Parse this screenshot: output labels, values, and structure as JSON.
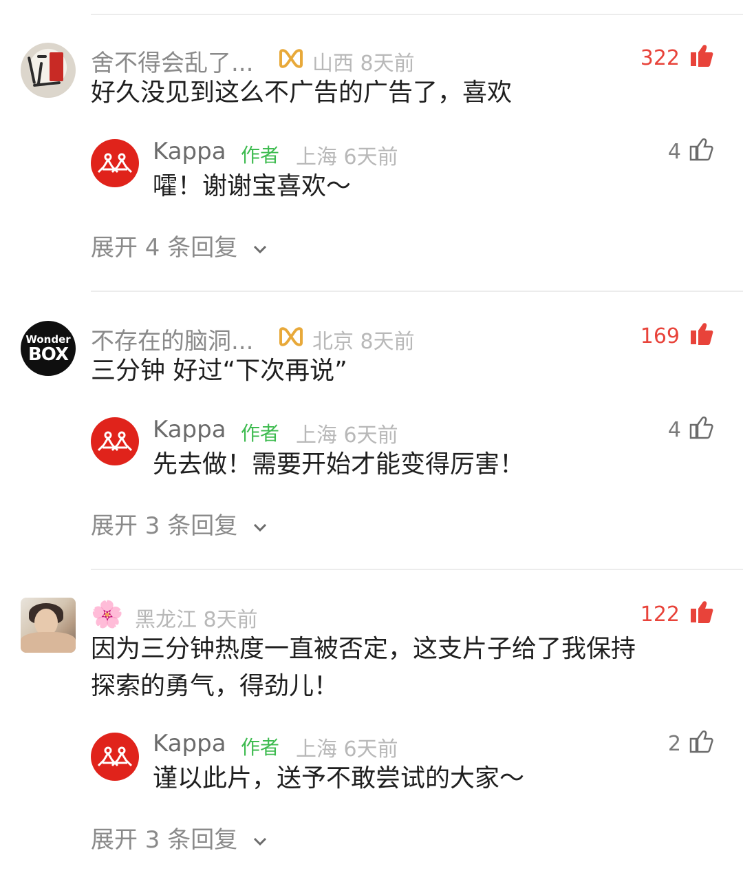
{
  "colors": {
    "accent_red": "#e8433a",
    "author_green": "#3dbb4f",
    "kappa_red": "#e0231b"
  },
  "comments": [
    {
      "user": "舍不得会乱了...",
      "badge_icon": "gold-infinity-icon",
      "location": "山西",
      "time": "8天前",
      "likes": "322",
      "text": "好久没见到这么不广告的广告了，喜欢",
      "reply": {
        "user": "Kappa",
        "tag": "作者",
        "location": "上海",
        "time": "6天前",
        "likes": "4",
        "text": "嚯！谢谢宝喜欢～"
      },
      "expand_label": "展开 4 条回复"
    },
    {
      "user": "不存在的脑洞...",
      "badge_icon": "gold-infinity-icon",
      "location": "北京",
      "time": "8天前",
      "likes": "169",
      "avatar_text": [
        "Wonder",
        "BOX"
      ],
      "text": "三分钟 好过“下次再说”",
      "reply": {
        "user": "Kappa",
        "tag": "作者",
        "location": "上海",
        "time": "6天前",
        "likes": "4",
        "text": "先去做！需要开始才能变得厉害！"
      },
      "expand_label": "展开 3 条回复"
    },
    {
      "user": "🌸",
      "location": "黑龙江",
      "time": "8天前",
      "likes": "122",
      "text_lines": [
        "因为三分钟热度一直被否定，这支片子给了我保持",
        "探索的勇气，得劲儿！"
      ],
      "reply": {
        "user": "Kappa",
        "tag": "作者",
        "location": "上海",
        "time": "6天前",
        "likes": "2",
        "text": "谨以此片，送予不敢尝试的大家～"
      },
      "expand_label": "展开 3 条回复"
    }
  ]
}
